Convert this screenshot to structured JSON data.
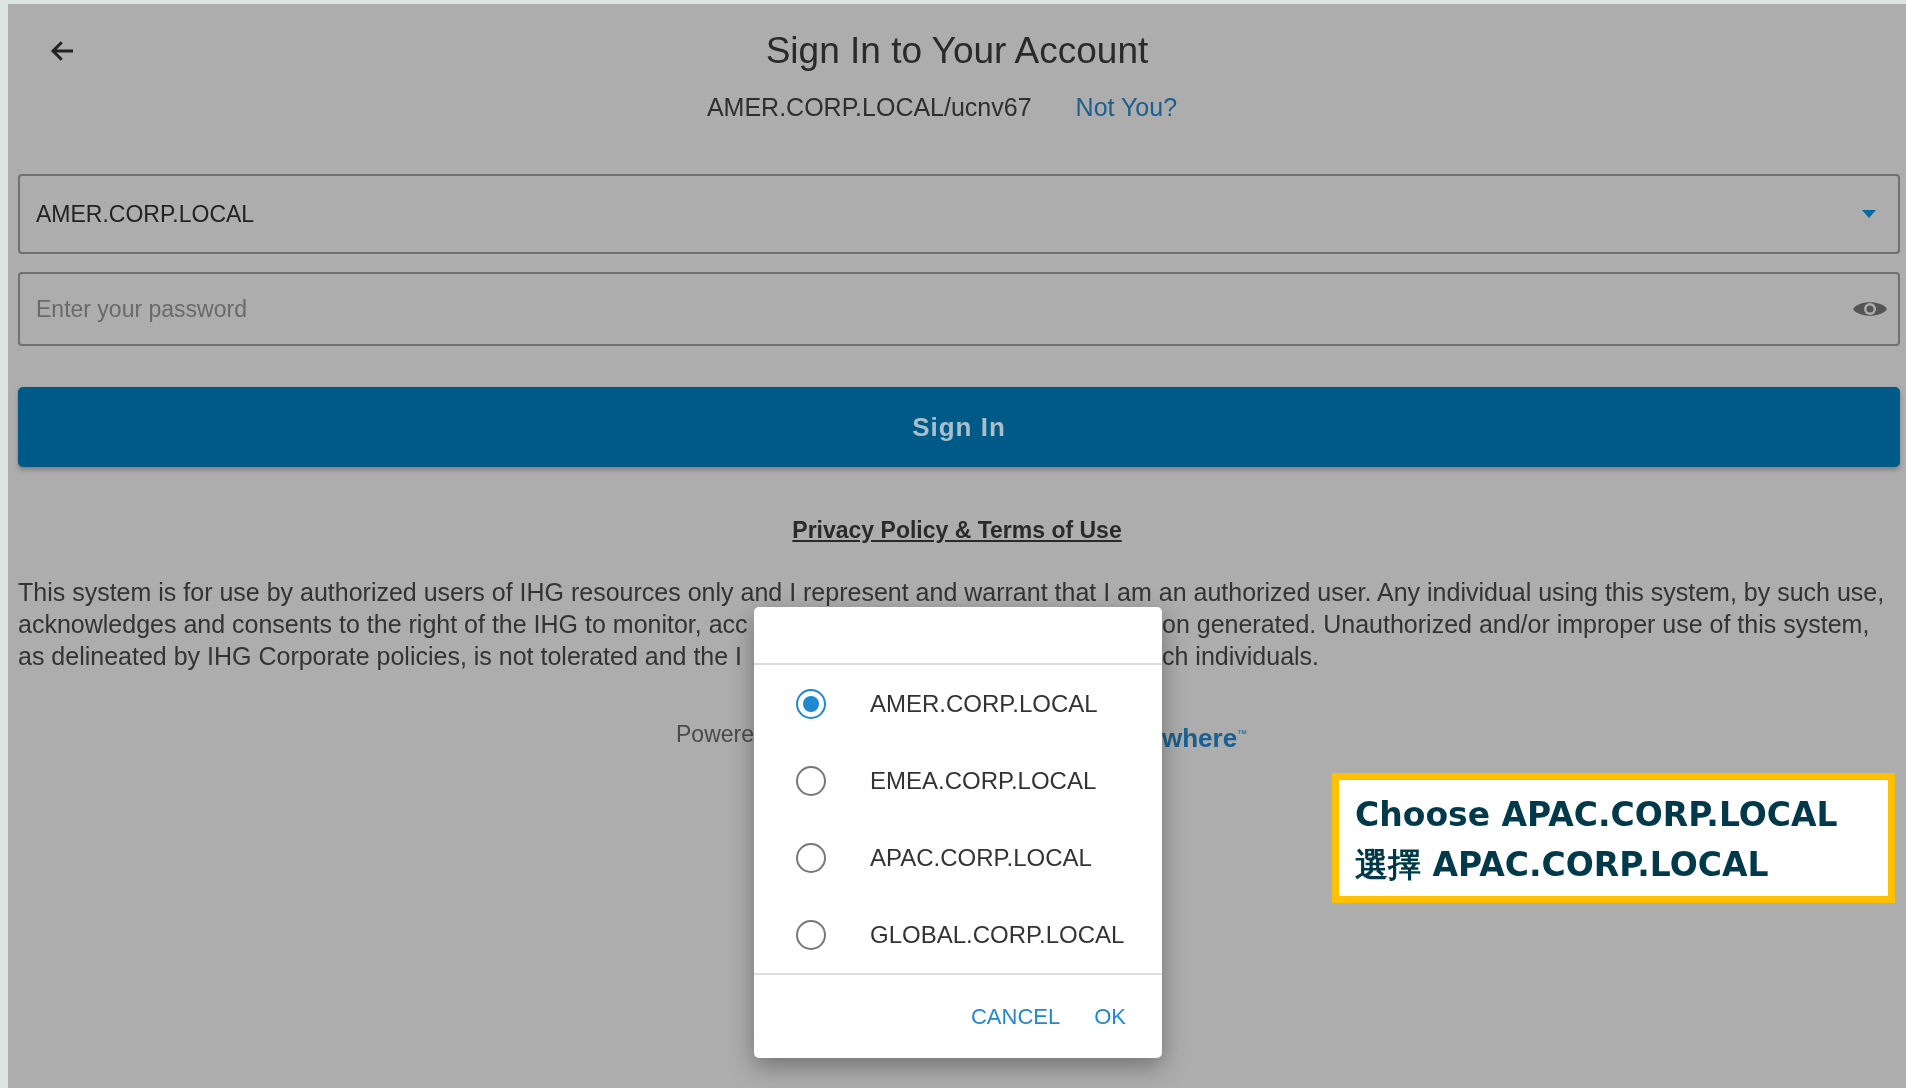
{
  "header": {
    "title": "Sign In to Your Account",
    "account": "AMER.CORP.LOCAL/ucnv67",
    "not_you_link": "Not You?"
  },
  "domain_select": {
    "value": "AMER.CORP.LOCAL"
  },
  "password": {
    "placeholder": "Enter your password"
  },
  "sign_in_button": "Sign In",
  "privacy_link": "Privacy Policy & Terms of Use",
  "notice_lines": [
    {
      "text": "This system is for use by authorized users of IHG resources only and I represent and warrant that I am an authorized user. Any individual using this system, by such use,"
    },
    {
      "left": "acknowledges and consents to the right of the IHG to monitor, acc",
      "right": "on generated. Unauthorized and/or improper use of this system,"
    },
    {
      "left": "as delineated by IHG Corporate policies, is not tolerated and the I",
      "right": "ch individuals."
    }
  ],
  "powered_by": {
    "left": "Powere",
    "right": "where$^{™}$"
  },
  "dialog": {
    "options": [
      {
        "label": "AMER.CORP.LOCAL",
        "selected": true
      },
      {
        "label": "EMEA.CORP.LOCAL",
        "selected": false
      },
      {
        "label": "APAC.CORP.LOCAL",
        "selected": false
      },
      {
        "label": "GLOBAL.CORP.LOCAL",
        "selected": false
      }
    ],
    "buttons": [
      "CANCEL",
      "OK"
    ]
  },
  "callout": {
    "lines": [
      "Choose APAC.CORP.LOCAL",
      "選擇 APAC.CORP.LOCAL"
    ]
  }
}
